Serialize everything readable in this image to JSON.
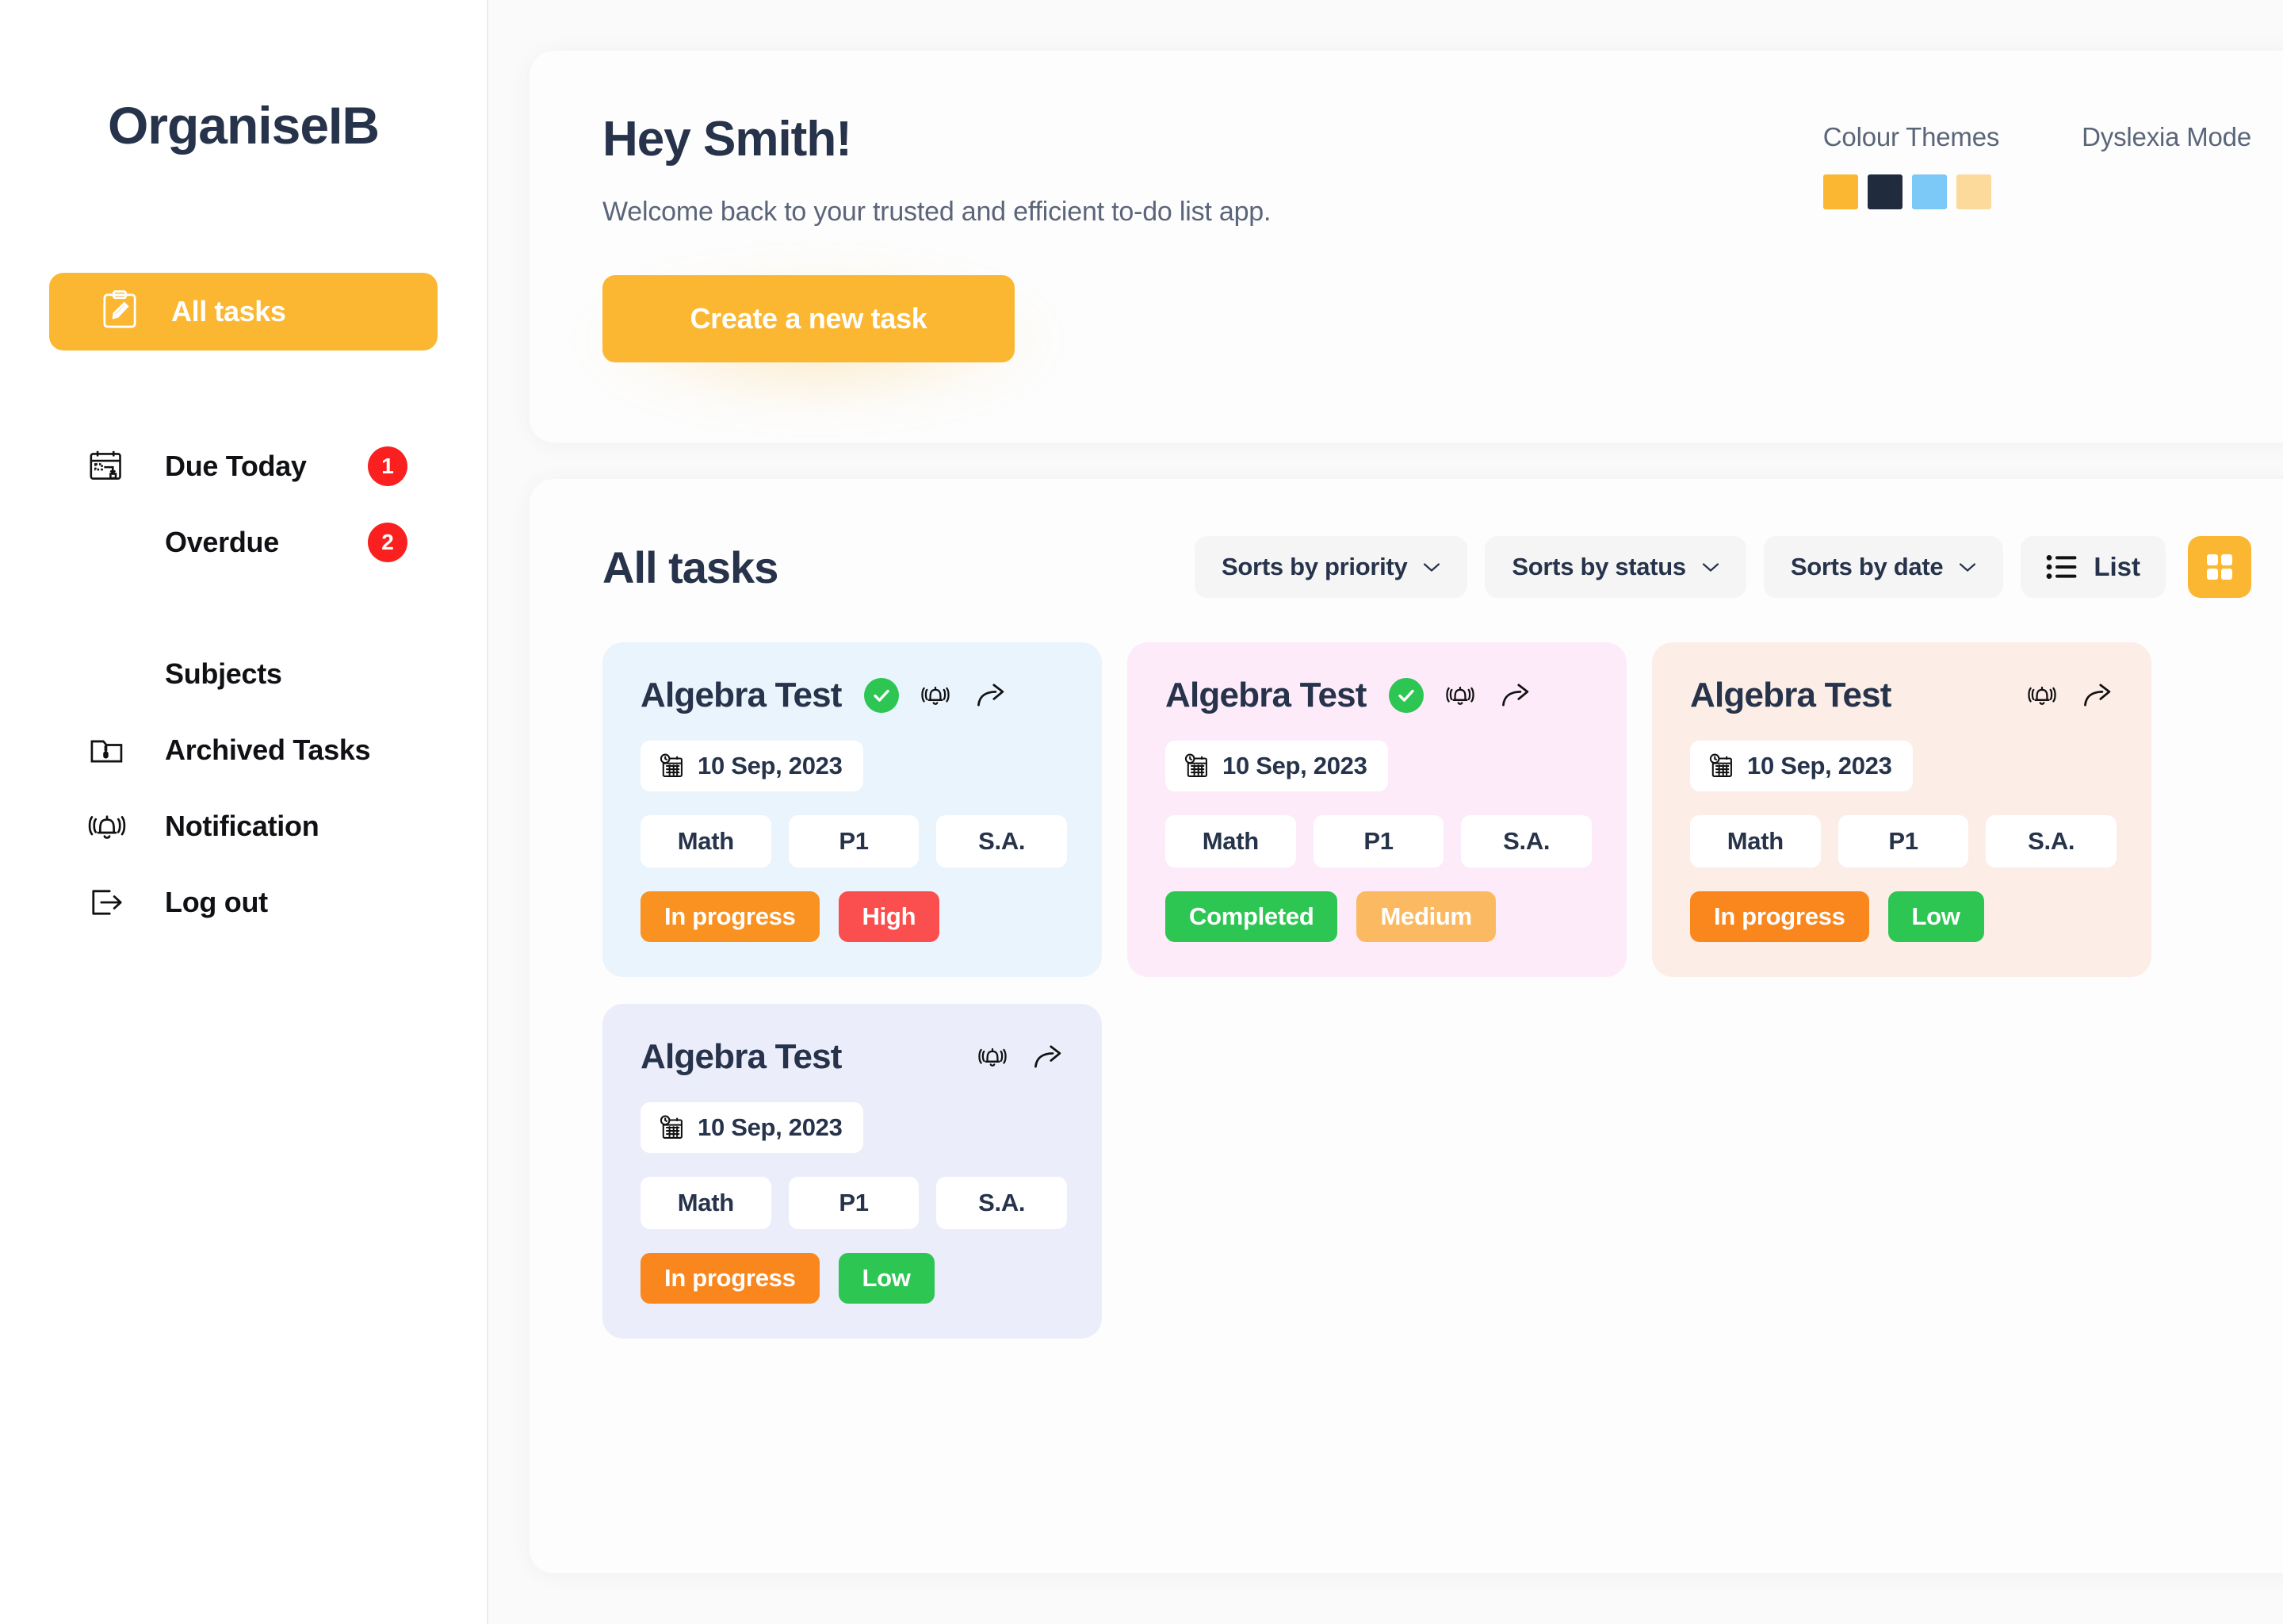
{
  "brand": "OrganiseIB",
  "sidebar": {
    "active": {
      "label": "All tasks",
      "icon": "clipboard-pencil-icon"
    },
    "items": [
      {
        "label": "Due Today",
        "icon": "calendar-due-icon",
        "badge": "1"
      },
      {
        "label": "Overdue",
        "icon": "",
        "badge": "2"
      },
      {
        "label": "Subjects",
        "icon": ""
      },
      {
        "label": "Archived Tasks",
        "icon": "archive-folder-icon"
      },
      {
        "label": "Notification",
        "icon": "bell-ring-icon"
      },
      {
        "label": "Log out",
        "icon": "logout-arrow-icon"
      }
    ]
  },
  "hero": {
    "greeting": "Hey Smith!",
    "subtitle": "Welcome back to your trusted and efficient to-do list app.",
    "create_button": "Create a new task",
    "colour_themes_label": "Colour Themes",
    "dyslexia_mode_label": "Dyslexia Mode",
    "swatches": [
      "#FBB731",
      "#212B3E",
      "#7CC8F7",
      "#FCDA9C"
    ]
  },
  "tasks": {
    "title": "All tasks",
    "sorts": [
      {
        "label": "Sorts by priority"
      },
      {
        "label": "Sorts by status"
      },
      {
        "label": "Sorts by date"
      }
    ],
    "view_list_label": "List",
    "cards": [
      {
        "title": "Algebra Test",
        "completed_check": true,
        "date": "10 Sep, 2023",
        "meta": [
          "Math",
          "P1",
          "S.A."
        ],
        "status": {
          "label": "In progress",
          "color": "#F99221"
        },
        "priority": {
          "label": "High",
          "color": "#FB4F4F"
        },
        "bg": "#EAF4FD"
      },
      {
        "title": "Algebra Test",
        "completed_check": true,
        "date": "10 Sep, 2023",
        "meta": [
          "Math",
          "P1",
          "S.A."
        ],
        "status": {
          "label": "Completed",
          "color": "#2DC653"
        },
        "priority": {
          "label": "Medium",
          "color": "#FBBA62"
        },
        "bg": "#FDEBFA"
      },
      {
        "title": "Algebra Test",
        "completed_check": false,
        "date": "10 Sep, 2023",
        "meta": [
          "Math",
          "P1",
          "S.A."
        ],
        "status": {
          "label": "In progress",
          "color": "#F9871E"
        },
        "priority": {
          "label": "Low",
          "color": "#2DC653"
        },
        "bg": "#FDEDE7"
      },
      {
        "title": "Algebra Test",
        "completed_check": false,
        "date": "10 Sep, 2023",
        "meta": [
          "Math",
          "P1",
          "S.A."
        ],
        "status": {
          "label": "In progress",
          "color": "#F9871E"
        },
        "priority": {
          "label": "Low",
          "color": "#2DC653"
        },
        "bg": "#EBEDFB"
      }
    ]
  }
}
